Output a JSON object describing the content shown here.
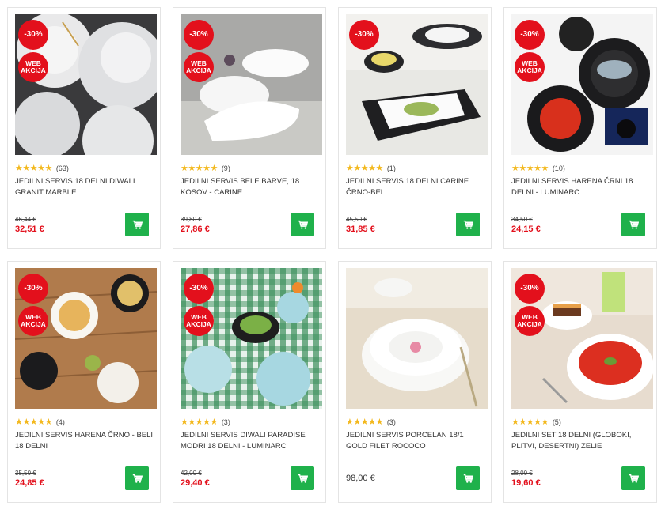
{
  "colors": {
    "accent_red": "#e3101c",
    "cart_green": "#1fb14b",
    "star": "#f3b81d"
  },
  "products": [
    {
      "discount": "-30%",
      "web_badge": "WEB\nAKCIJA",
      "stars": "★★★★★",
      "reviews": "(63)",
      "title": "JEDILNI SERVIS 18 DELNI DIWALI GRANIT MARBLE",
      "old_price": "46,44 €",
      "price": "32,51 €"
    },
    {
      "discount": "-30%",
      "web_badge": "WEB\nAKCIJA",
      "stars": "★★★★★",
      "reviews": "(9)",
      "title": "JEDILNI SERVIS BELE BARVE, 18 KOSOV - CARINE",
      "old_price": "39,80 €",
      "price": "27,86 €"
    },
    {
      "discount": "-30%",
      "web_badge": "",
      "stars": "★★★★★",
      "reviews": "(1)",
      "title": "JEDILNI SERVIS 18 DELNI CARINE ČRNO-BELI",
      "old_price": "45,50 €",
      "price": "31,85 €"
    },
    {
      "discount": "-30%",
      "web_badge": "WEB\nAKCIJA",
      "stars": "★★★★★",
      "reviews": "(10)",
      "title": "JEDILNI SERVIS HARENA ČRNI 18 DELNI - LUMINARC",
      "old_price": "34,50 €",
      "price": "24,15 €"
    },
    {
      "discount": "-30%",
      "web_badge": "WEB\nAKCIJA",
      "stars": "★★★★★",
      "reviews": "(4)",
      "title": "JEDILNI SERVIS HARENA ČRNO - BELI 18 DELNI",
      "old_price": "35,50 €",
      "price": "24,85 €"
    },
    {
      "discount": "-30%",
      "web_badge": "WEB\nAKCIJA",
      "stars": "★★★★★",
      "reviews": "(3)",
      "title": "JEDILNI SERVIS DIWALI PARADISE MODRI 18 DELNI - LUMINARC",
      "old_price": "42,00 €",
      "price": "29,40 €"
    },
    {
      "discount": "",
      "web_badge": "",
      "stars": "★★★★★",
      "reviews": "(3)",
      "title": "JEDILNI SERVIS PORCELAN 18/1 GOLD FILET ROCOCO",
      "old_price": "",
      "price": "98,00 €"
    },
    {
      "discount": "-30%",
      "web_badge": "WEB\nAKCIJA",
      "stars": "★★★★★",
      "reviews": "(5)",
      "title": "JEDILNI SET 18 DELNI (GLOBOKI, PLITVI, DESERTNI) ZELIE",
      "old_price": "28,00 €",
      "price": "19,60 €"
    }
  ],
  "icons": {
    "cart": "shopping-cart-icon"
  }
}
